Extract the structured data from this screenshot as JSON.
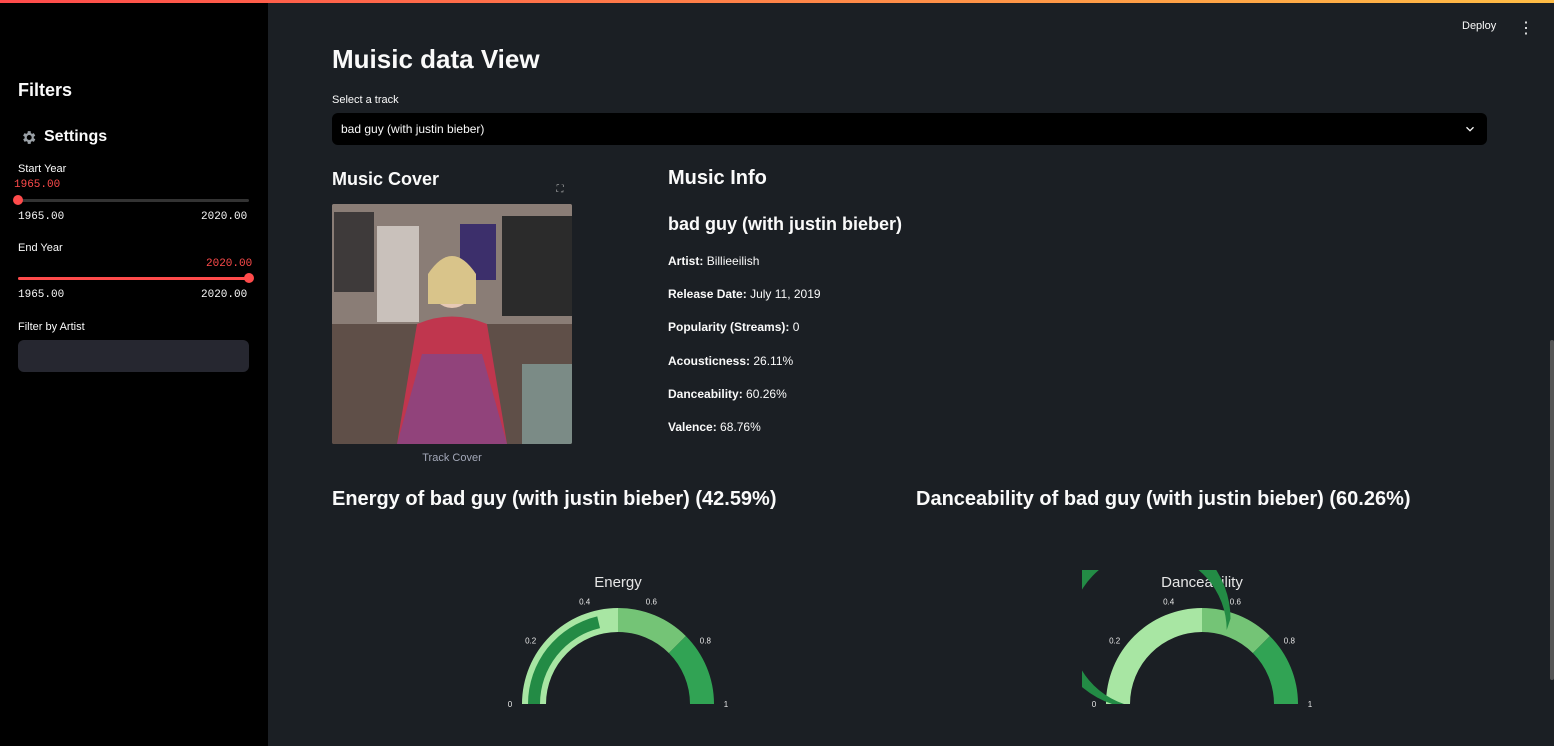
{
  "sidebar": {
    "filters_title": "Filters",
    "settings_title": "Settings",
    "start_year": {
      "label": "Start Year",
      "value": "1965.00",
      "min": "1965.00",
      "max": "2020.00",
      "fraction": 0.0
    },
    "end_year": {
      "label": "End Year",
      "value": "2020.00",
      "min": "1965.00",
      "max": "2020.00",
      "fraction": 1.0
    },
    "artist_filter": {
      "label": "Filter by Artist",
      "value": ""
    }
  },
  "header": {
    "deploy_label": "Deploy",
    "menu_icon": "⋮"
  },
  "main": {
    "title": "Muisic data View",
    "select_label": "Select a track",
    "selected_track": "bad guy (with justin bieber)",
    "cover_heading": "Music Cover",
    "cover_caption": "Track Cover",
    "info_heading": "Music Info",
    "track_title": "bad guy (with justin bieber)",
    "info": [
      {
        "label": "Artist:",
        "value": "Billieeilish"
      },
      {
        "label": "Release Date:",
        "value": "July 11, 2019"
      },
      {
        "label": "Popularity (Streams):",
        "value": "0"
      },
      {
        "label": "Acousticness:",
        "value": "26.11%"
      },
      {
        "label": "Danceability:",
        "value": "60.26%"
      },
      {
        "label": "Valence:",
        "value": "68.76%"
      }
    ],
    "energy_heading": "Energy of bad guy (with justin bieber) (42.59%)",
    "dance_heading": "Danceability of bad guy (with justin bieber) (60.26%)"
  },
  "gauges": [
    {
      "title": "Energy",
      "value": 0.4259,
      "ticks": [
        "0",
        "0.2",
        "0.4",
        "0.6",
        "0.8",
        "1"
      ]
    },
    {
      "title": "Danceability",
      "value": 0.6026,
      "ticks": [
        "0",
        "0.2",
        "0.4",
        "0.6",
        "0.8",
        "1"
      ]
    }
  ],
  "colors": {
    "accent": "#ff4b4b",
    "gauge_light": "#a8e6a3",
    "gauge_mid": "#74c476",
    "gauge_dark": "#31a354",
    "gauge_bar": "#238b45"
  }
}
